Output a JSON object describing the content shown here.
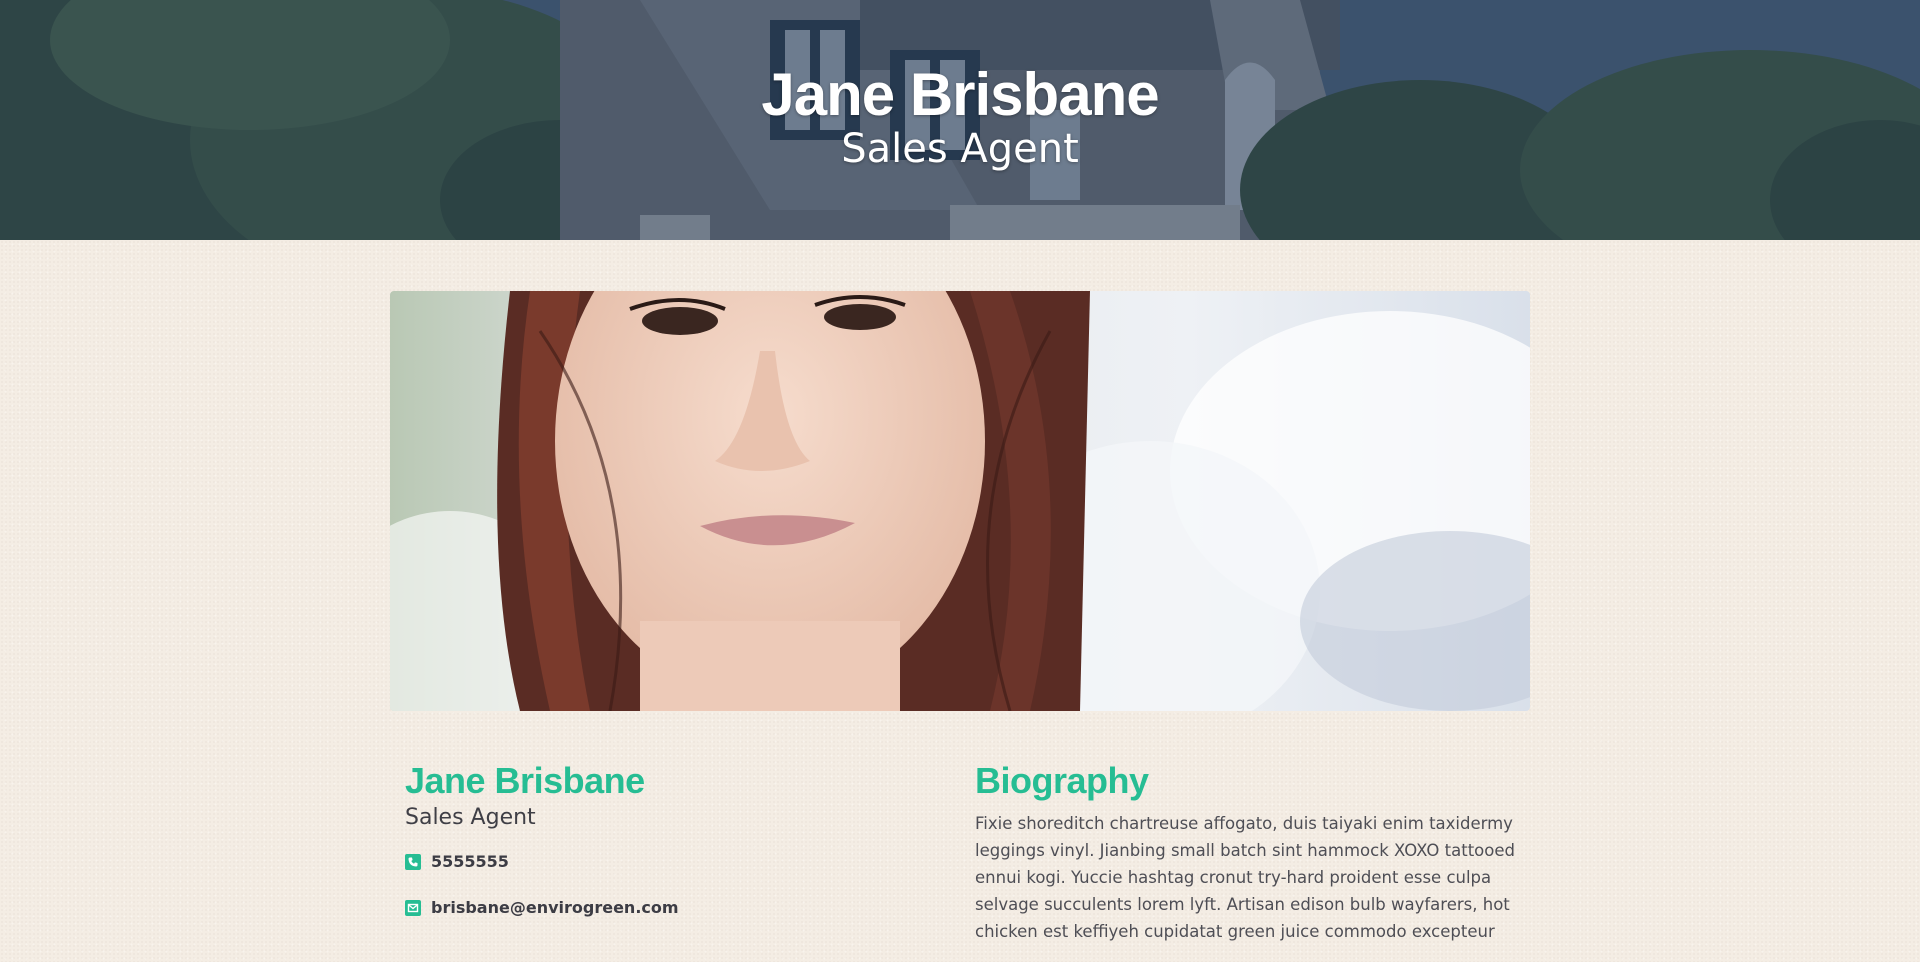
{
  "hero": {
    "name": "Jane Brisbane",
    "role": "Sales Agent"
  },
  "portrait": {
    "alt_subject": "agent-portrait"
  },
  "profile": {
    "name": "Jane Brisbane",
    "role": "Sales Agent",
    "phone_icon": "phone-icon",
    "phone": "5555555",
    "email_icon": "envelope-icon",
    "email": "brisbane@envirogreen.com"
  },
  "biography": {
    "title": "Biography",
    "text": "Fixie shoreditch chartreuse affogato, duis taiyaki enim taxidermy leggings vinyl. Jianbing small batch sint hammock XOXO tattooed ennui kogi. Yuccie hashtag cronut try-hard proident esse culpa selvage succulents lorem lyft. Artisan edison bulb wayfarers, hot chicken est keffiyeh cupidatat green juice commodo excepteur"
  },
  "colors": {
    "accent": "#26bd93",
    "hero_tint": "#203450",
    "page_bg": "#f4ede4"
  }
}
